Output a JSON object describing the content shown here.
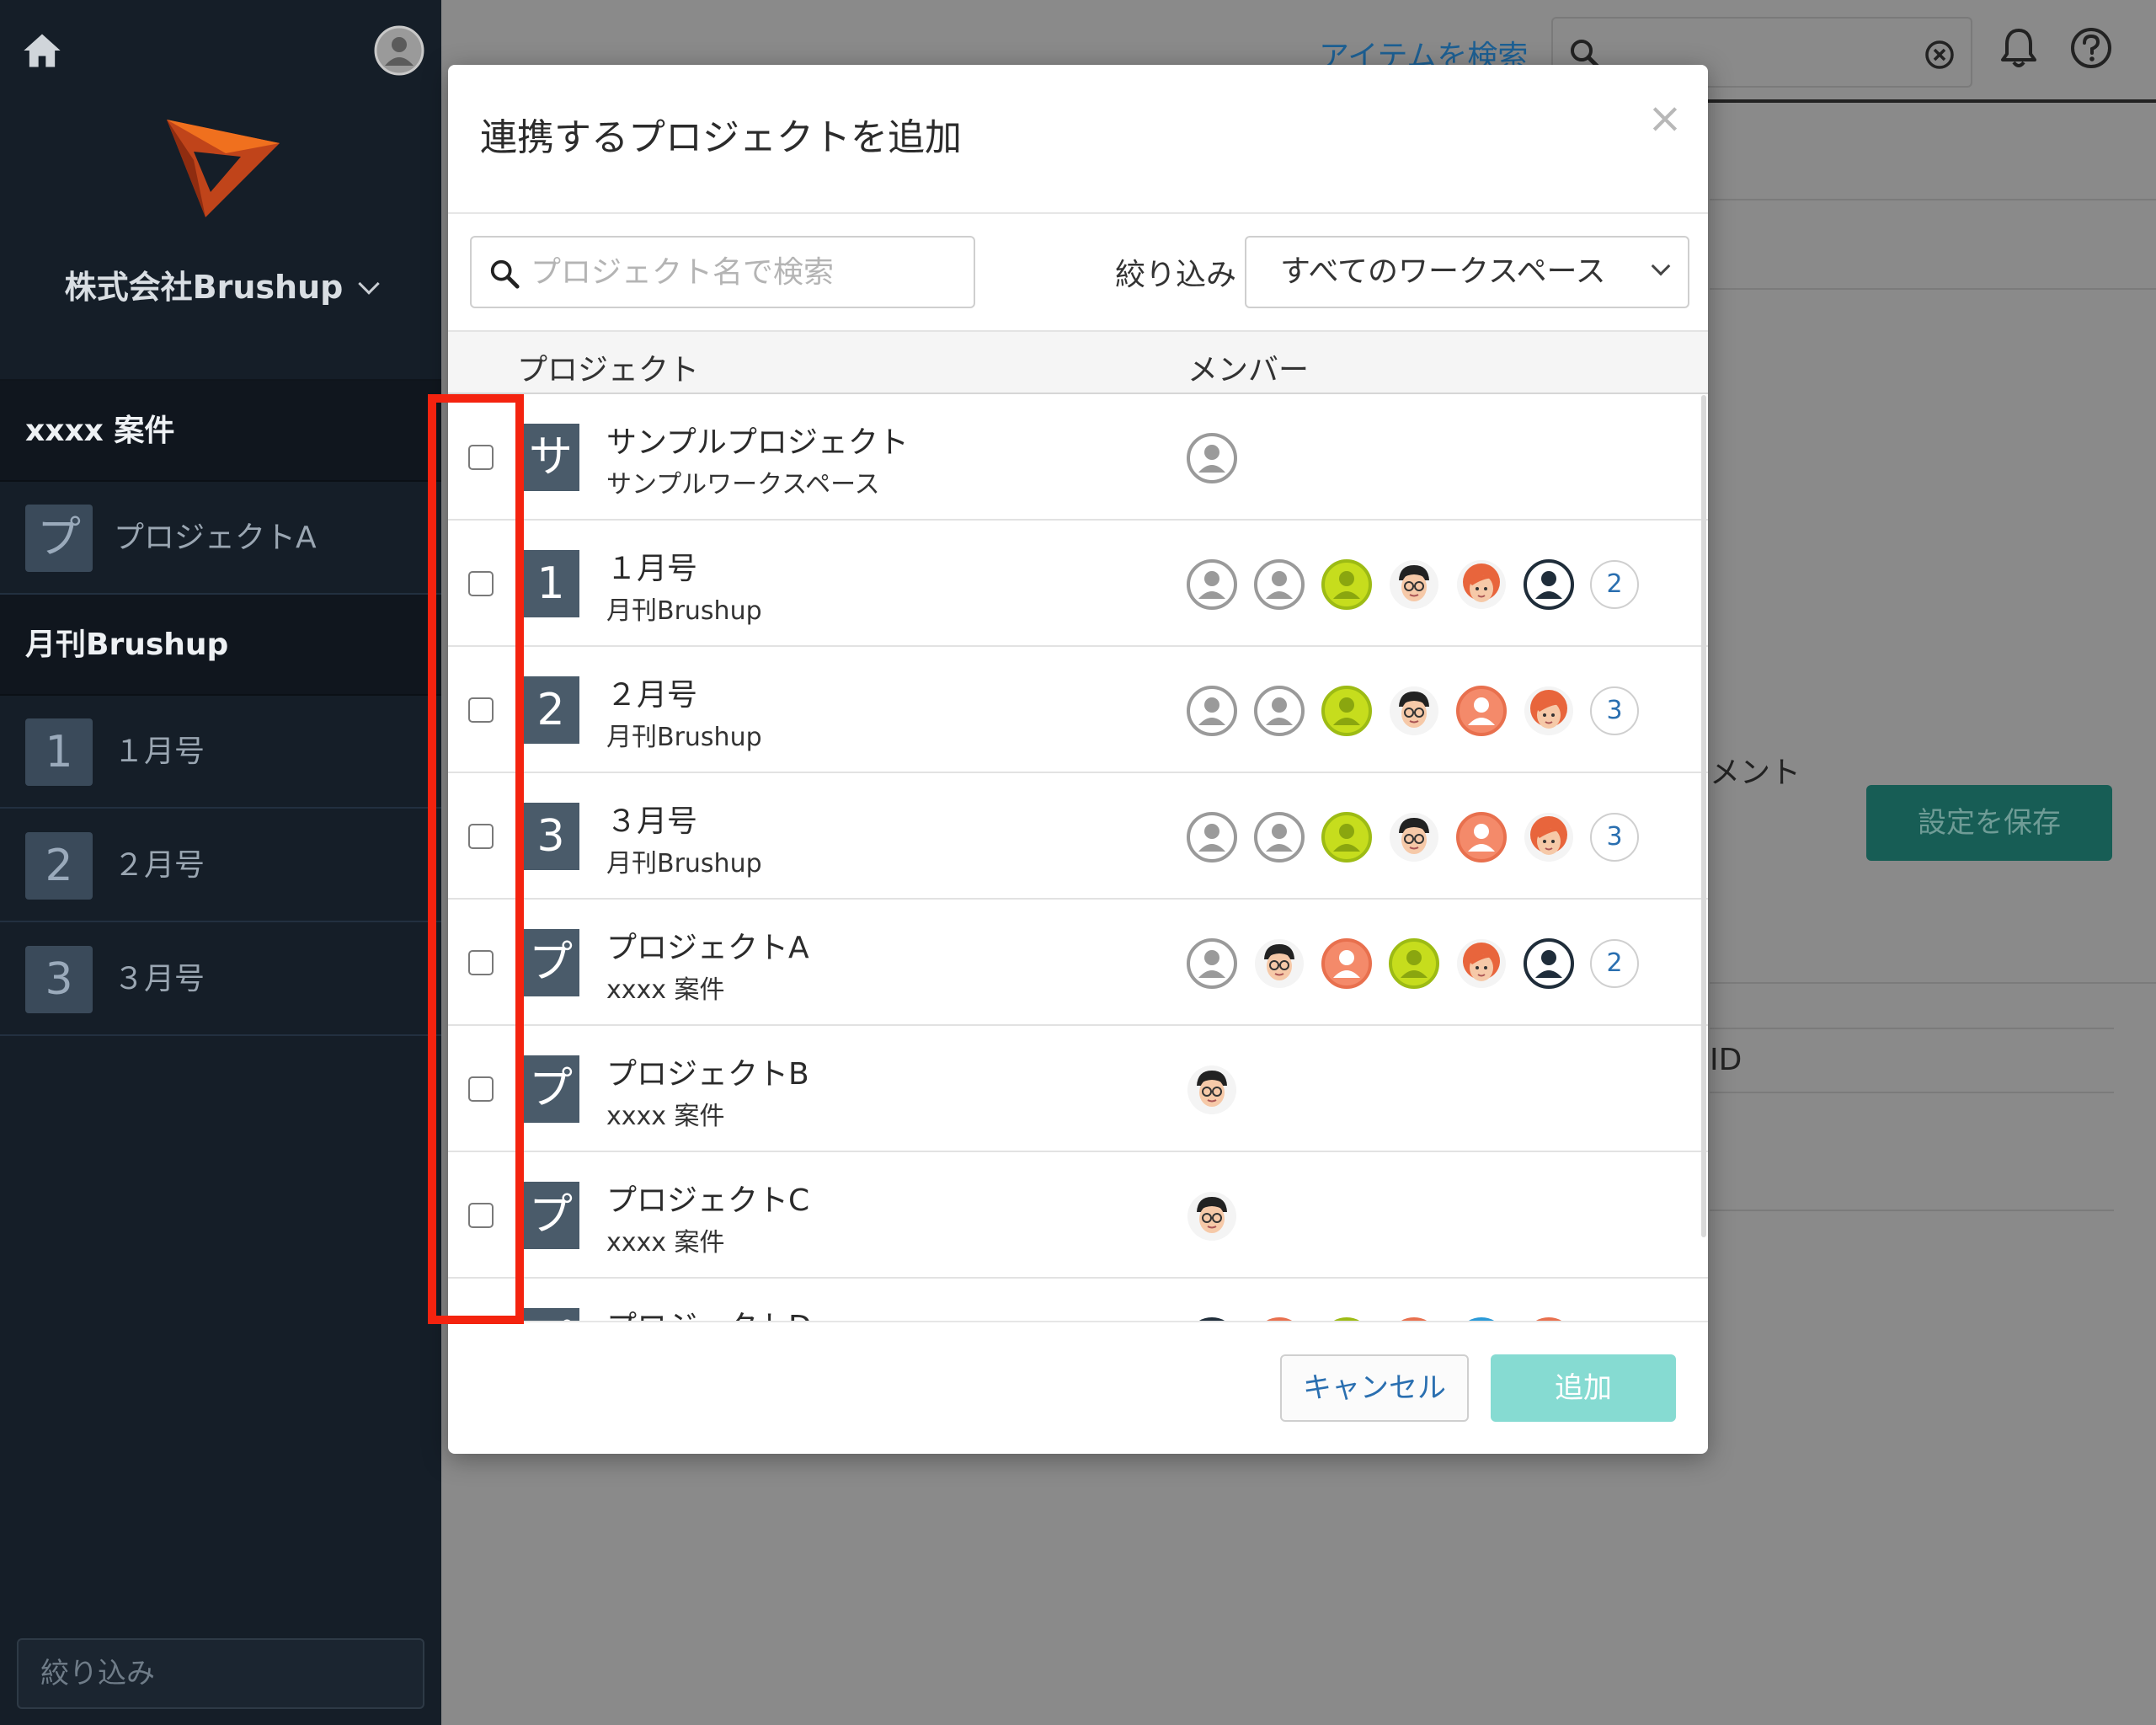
{
  "sidebar": {
    "org_name": "株式会社Brushup",
    "groups": [
      {
        "label": "xxxx 案件"
      },
      {
        "label": "月刊Brushup"
      }
    ],
    "items": [
      {
        "badge": "プ",
        "label": "プロジェクトA"
      },
      {
        "badge": "1",
        "label": "１月号"
      },
      {
        "badge": "2",
        "label": "２月号"
      },
      {
        "badge": "3",
        "label": "３月号"
      }
    ],
    "filter_placeholder": "絞り込み"
  },
  "header": {
    "search_link": "アイテムを検索"
  },
  "background": {
    "comment_fragment": "メント",
    "save_button": "設定を保存",
    "id_fragment": "ID"
  },
  "modal": {
    "title": "連携するプロジェクトを追加",
    "close": "×",
    "search_placeholder": "プロジェクト名で検索",
    "filter_label": "絞り込み",
    "filter_value": "すべてのワークスペース",
    "col_project": "プロジェクト",
    "col_members": "メンバー",
    "rows": [
      {
        "badge": "サ",
        "name": "サンプルプロジェクト",
        "workspace": "サンプルワークスペース",
        "members": [
          "gray"
        ],
        "more": ""
      },
      {
        "badge": "1",
        "name": "１月号",
        "workspace": "月刊Brushup",
        "members": [
          "gray",
          "gray",
          "lime",
          "face-man",
          "face-woman",
          "dark"
        ],
        "more": "2"
      },
      {
        "badge": "2",
        "name": "２月号",
        "workspace": "月刊Brushup",
        "members": [
          "gray",
          "gray",
          "lime",
          "face-man",
          "salmon",
          "face-woman"
        ],
        "more": "3"
      },
      {
        "badge": "3",
        "name": "３月号",
        "workspace": "月刊Brushup",
        "members": [
          "gray",
          "gray",
          "lime",
          "face-man",
          "salmon",
          "face-woman"
        ],
        "more": "3"
      },
      {
        "badge": "プ",
        "name": "プロジェクトA",
        "workspace": "xxxx 案件",
        "members": [
          "gray",
          "face-man",
          "salmon",
          "lime",
          "face-woman",
          "dark"
        ],
        "more": "2"
      },
      {
        "badge": "プ",
        "name": "プロジェクトB",
        "workspace": "xxxx 案件",
        "members": [
          "face-man"
        ],
        "more": ""
      },
      {
        "badge": "プ",
        "name": "プロジェクトC",
        "workspace": "xxxx 案件",
        "members": [
          "face-man"
        ],
        "more": ""
      },
      {
        "badge": "プ",
        "name": "プロジェクトD",
        "workspace": "",
        "members": [
          "dark",
          "salmon",
          "lime",
          "salmon",
          "blue",
          "salmon"
        ],
        "more": ""
      }
    ],
    "cancel_label": "キャンセル",
    "add_label": "追加"
  },
  "colors": {
    "sidebar_bg": "#151e28",
    "accent_teal": "#86dbd2",
    "highlight_red": "#f4230f",
    "link_blue": "#2a6fb0"
  }
}
